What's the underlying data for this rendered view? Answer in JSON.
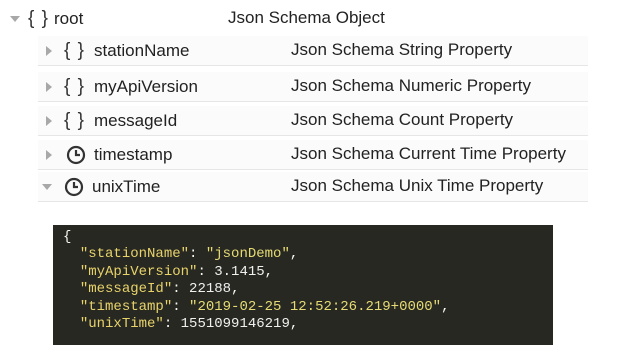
{
  "tree": {
    "root": {
      "label": "root",
      "type": "Json Schema Object",
      "icon": "braces-icon",
      "expanded": true
    },
    "children": [
      {
        "label": "stationName",
        "type": "Json Schema String Property",
        "icon": "braces-icon",
        "expanded": false
      },
      {
        "label": "myApiVersion",
        "type": "Json Schema Numeric Property",
        "icon": "braces-icon",
        "expanded": false
      },
      {
        "label": "messageId",
        "type": "Json Schema Count Property",
        "icon": "braces-icon",
        "expanded": false
      },
      {
        "label": "timestamp",
        "type": "Json Schema Current Time Property",
        "icon": "clock-icon",
        "expanded": false
      },
      {
        "label": "unixTime",
        "type": "Json Schema Unix Time Property",
        "icon": "clock-icon",
        "expanded": true
      }
    ]
  },
  "braces_glyph": "{ }",
  "json_preview": {
    "open_brace": "{",
    "lines": [
      {
        "key": "\"stationName\"",
        "sep": ": ",
        "value": "\"jsonDemo\"",
        "value_kind": "string",
        "end": ","
      },
      {
        "key": "\"myApiVersion\"",
        "sep": ": ",
        "value": "3.1415",
        "value_kind": "number",
        "end": ","
      },
      {
        "key": "\"messageId\"",
        "sep": ": ",
        "value": "22188",
        "value_kind": "number",
        "end": ","
      },
      {
        "key": "\"timestamp\"",
        "sep": ": ",
        "value": "\"2019-02-25 12:52:26.219+0000\"",
        "value_kind": "string",
        "end": ","
      },
      {
        "key": "\"unixTime\"",
        "sep": ": ",
        "value": "1551099146219",
        "value_kind": "number",
        "end": ","
      }
    ]
  },
  "colors": {
    "code_background": "#272822",
    "code_key": "#e8d36b",
    "code_string": "#e6db74",
    "code_text": "#f8f8f2",
    "row_divider": "#e6e6e6"
  }
}
